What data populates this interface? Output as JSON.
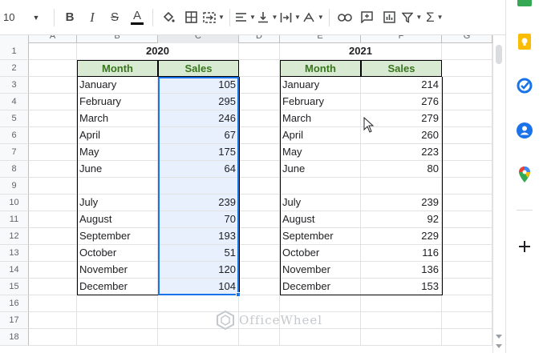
{
  "toolbar": {
    "font_size": "10",
    "buttons": [
      {
        "name": "bold-button",
        "label": "B"
      },
      {
        "name": "italic-button",
        "label": "I"
      },
      {
        "name": "strikethrough-button",
        "label": "S"
      },
      {
        "name": "text-color-button",
        "label": "A"
      }
    ]
  },
  "grid": {
    "column_letters": [
      "A",
      "B",
      "C",
      "D",
      "E",
      "F",
      "G"
    ],
    "row_numbers": [
      "1",
      "2",
      "3",
      "4",
      "5",
      "6",
      "7",
      "8",
      "9",
      "10",
      "11",
      "12",
      "13",
      "14",
      "15",
      "16",
      "17",
      "18"
    ],
    "table_2020": {
      "year": "2020",
      "headers": {
        "month": "Month",
        "sales": "Sales"
      },
      "rows": [
        {
          "month": "January",
          "sales": "105"
        },
        {
          "month": "February",
          "sales": "295"
        },
        {
          "month": "March",
          "sales": "246"
        },
        {
          "month": "April",
          "sales": "67"
        },
        {
          "month": "May",
          "sales": "175"
        },
        {
          "month": "June",
          "sales": "64"
        },
        {
          "month": "",
          "sales": ""
        },
        {
          "month": "July",
          "sales": "239"
        },
        {
          "month": "August",
          "sales": "70"
        },
        {
          "month": "September",
          "sales": "193"
        },
        {
          "month": "October",
          "sales": "51"
        },
        {
          "month": "November",
          "sales": "120"
        },
        {
          "month": "December",
          "sales": "104"
        }
      ]
    },
    "table_2021": {
      "year": "2021",
      "headers": {
        "month": "Month",
        "sales": "Sales"
      },
      "rows": [
        {
          "month": "January",
          "sales": "214"
        },
        {
          "month": "February",
          "sales": "276"
        },
        {
          "month": "March",
          "sales": "279"
        },
        {
          "month": "April",
          "sales": "260"
        },
        {
          "month": "May",
          "sales": "223"
        },
        {
          "month": "June",
          "sales": "80"
        },
        {
          "month": "",
          "sales": ""
        },
        {
          "month": "July",
          "sales": "239"
        },
        {
          "month": "August",
          "sales": "92"
        },
        {
          "month": "September",
          "sales": "229"
        },
        {
          "month": "October",
          "sales": "116"
        },
        {
          "month": "November",
          "sales": "136"
        },
        {
          "month": "December",
          "sales": "153"
        }
      ]
    }
  },
  "watermark": {
    "text": "OfficeWheel"
  },
  "colors": {
    "header_fill": "#d9ead3",
    "header_text": "#38761d",
    "selection": "#1a73e8",
    "selection_fill": "#e8f0fe"
  },
  "side_panel": {
    "icons": [
      "keep-icon",
      "tasks-icon",
      "contacts-icon",
      "maps-icon",
      "add-icon"
    ]
  }
}
